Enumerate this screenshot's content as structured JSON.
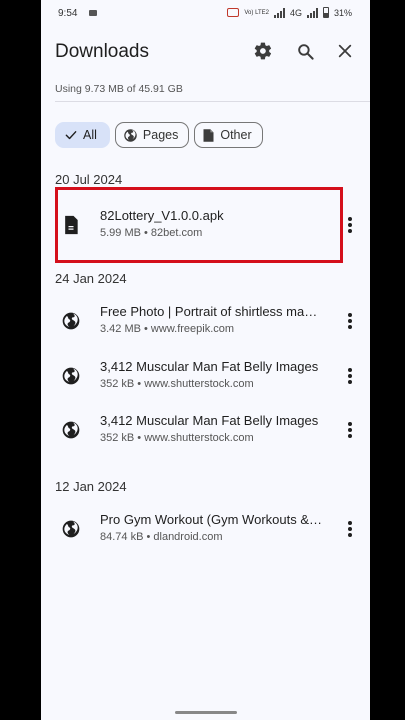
{
  "status": {
    "time": "9:54",
    "battery": "31%",
    "net_label": "4G",
    "lte_label": "Vo) LTE2"
  },
  "header": {
    "title": "Downloads"
  },
  "storage": {
    "text": "Using 9.73 MB of 45.91 GB"
  },
  "filters": [
    {
      "label": "All",
      "active": true
    },
    {
      "label": "Pages",
      "active": false
    },
    {
      "label": "Other",
      "active": false
    }
  ],
  "groups": [
    {
      "date": "20 Jul 2024",
      "items": [
        {
          "name": "82Lottery_V1.0.0.apk",
          "meta": "5.99 MB • 82bet.com",
          "icon": "file-icon"
        }
      ]
    },
    {
      "date": "24 Jan 2024",
      "items": [
        {
          "name": "Free Photo | Portrait of shirtless man with fat belly",
          "meta": "3.42 MB • www.freepik.com",
          "icon": "globe-icon"
        },
        {
          "name": "3,412 Muscular Man Fat Belly Images",
          "meta": "352 kB • www.shutterstock.com",
          "icon": "globe-icon"
        },
        {
          "name": "3,412 Muscular Man Fat Belly Images",
          "meta": "352 kB • www.shutterstock.com",
          "icon": "globe-icon"
        }
      ]
    },
    {
      "date": "12 Jan 2024",
      "items": [
        {
          "name": "Pro Gym Workout (Gym Workouts & Fitness)",
          "meta": "84.74 kB • dlandroid.com",
          "icon": "globe-icon"
        }
      ]
    }
  ],
  "colors": {
    "accent_chip": "#d8e2f8",
    "highlight": "#d40f1c",
    "background": "#f8f9fe"
  }
}
